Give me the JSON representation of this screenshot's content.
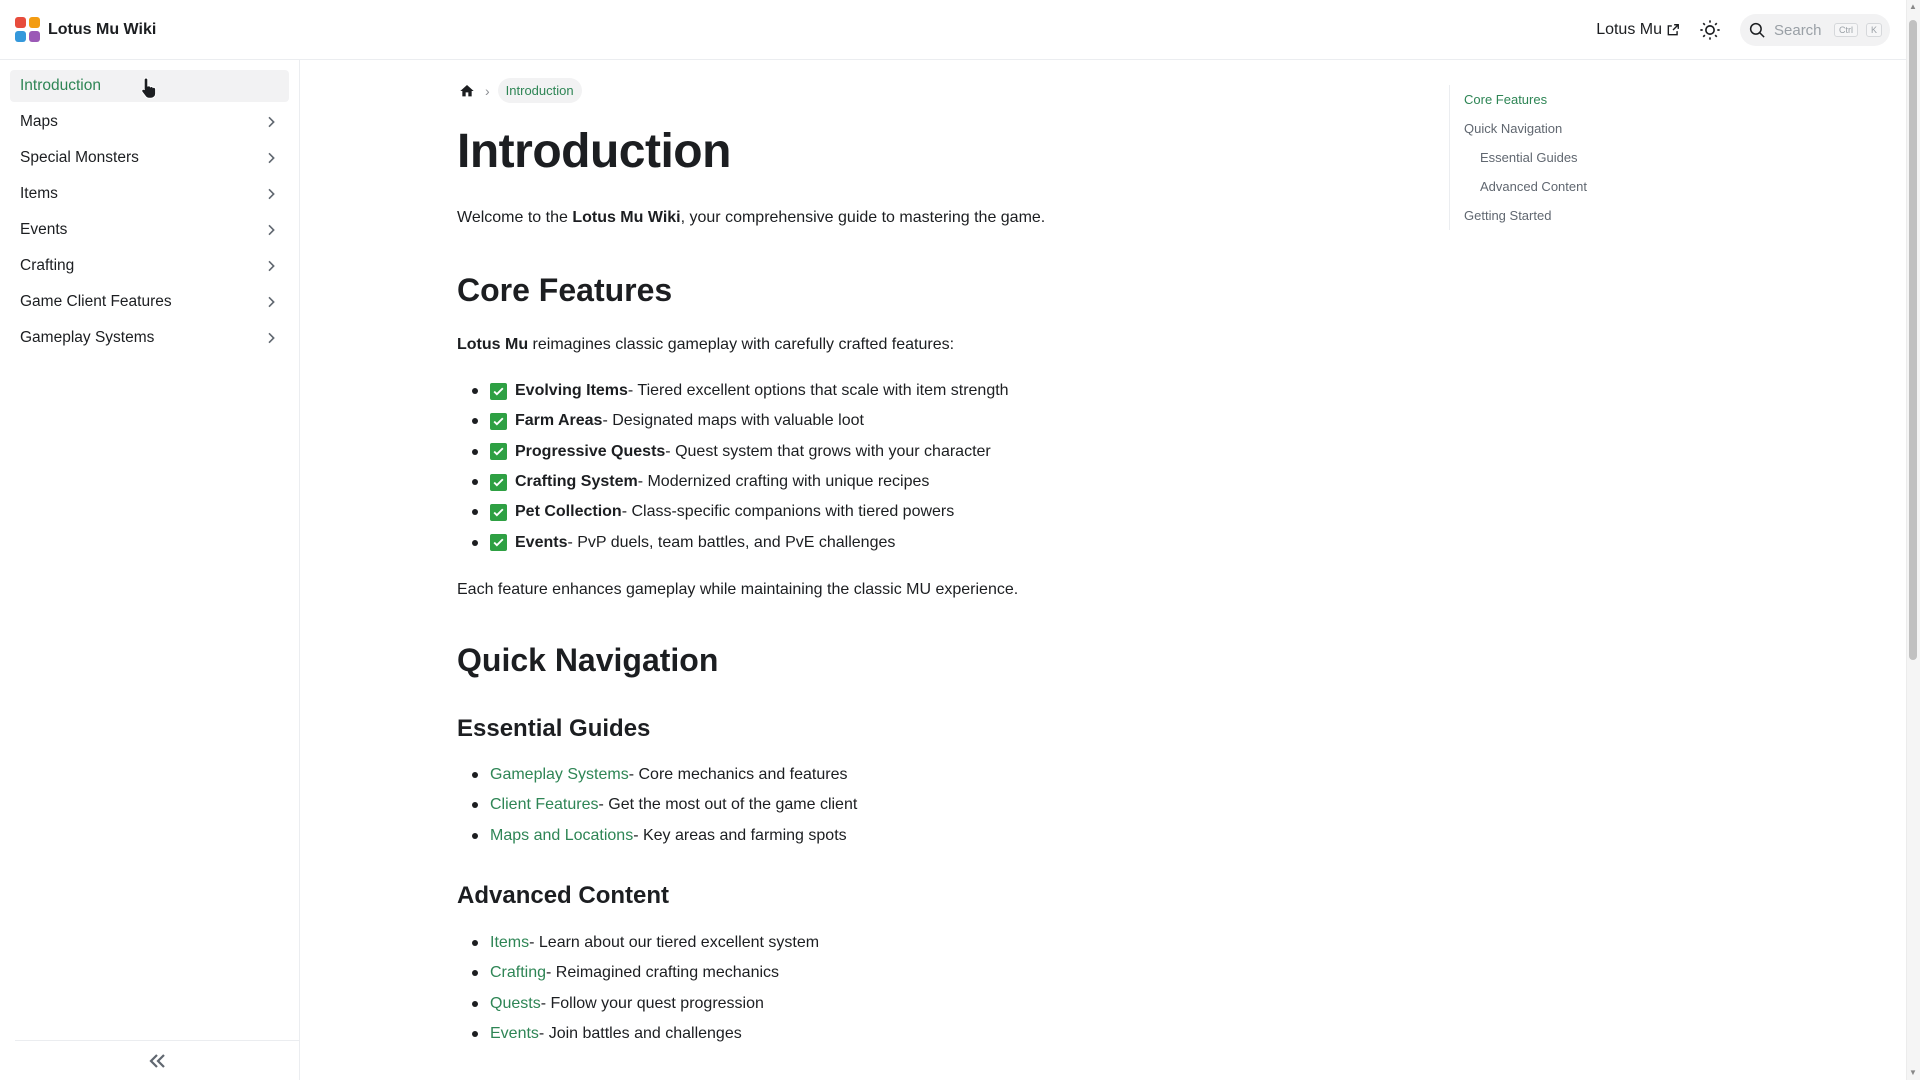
{
  "navbar": {
    "brand_title": "Lotus Mu Wiki",
    "logo_colors": [
      "#e74c3c",
      "#f39c12",
      "#3498db",
      "#9b59b6"
    ],
    "external_link_label": "Lotus Mu",
    "search_placeholder": "Search",
    "search_kbd_1": "Ctrl",
    "search_kbd_2": "K"
  },
  "sidebar": {
    "items": [
      {
        "label": "Introduction",
        "active": true
      },
      {
        "label": "Maps"
      },
      {
        "label": "Special Monsters"
      },
      {
        "label": "Items"
      },
      {
        "label": "Events"
      },
      {
        "label": "Crafting"
      },
      {
        "label": "Game Client Features"
      },
      {
        "label": "Gameplay Systems"
      }
    ]
  },
  "breadcrumb": {
    "current": "Introduction"
  },
  "main": {
    "title": "Introduction",
    "intro_prefix": "Welcome to the ",
    "intro_bold": "Lotus Mu Wiki",
    "intro_suffix": ", your comprehensive guide to mastering the game.",
    "core_features": {
      "heading": "Core Features",
      "lead_bold": "Lotus Mu",
      "lead_rest": " reimagines classic gameplay with carefully crafted features:",
      "items": [
        {
          "name": "Evolving Items",
          "desc": " - Tiered excellent options that scale with item strength"
        },
        {
          "name": "Farm Areas",
          "desc": " - Designated maps with valuable loot"
        },
        {
          "name": "Progressive Quests",
          "desc": " - Quest system that grows with your character"
        },
        {
          "name": "Crafting System",
          "desc": " - Modernized crafting with unique recipes"
        },
        {
          "name": "Pet Collection",
          "desc": " - Class-specific companions with tiered powers"
        },
        {
          "name": "Events",
          "desc": " - PvP duels, team battles, and PvE challenges"
        }
      ],
      "closing": "Each feature enhances gameplay while maintaining the classic MU experience."
    },
    "quick_navigation": {
      "heading": "Quick Navigation",
      "essential_guides": {
        "heading": "Essential Guides",
        "items": [
          {
            "link": "Gameplay Systems",
            "desc": " - Core mechanics and features"
          },
          {
            "link": "Client Features",
            "desc": " - Get the most out of the game client"
          },
          {
            "link": "Maps and Locations",
            "desc": " - Key areas and farming spots"
          }
        ]
      },
      "advanced_content": {
        "heading": "Advanced Content",
        "items": [
          {
            "link": "Items",
            "desc": " - Learn about our tiered excellent system"
          },
          {
            "link": "Crafting",
            "desc": " - Reimagined crafting mechanics"
          },
          {
            "link": "Quests",
            "desc": " - Follow your quest progression"
          },
          {
            "link": "Events",
            "desc": " - Join battles and challenges"
          }
        ]
      }
    }
  },
  "toc": {
    "items": [
      {
        "label": "Core Features",
        "level": 1,
        "active": true
      },
      {
        "label": "Quick Navigation",
        "level": 1
      },
      {
        "label": "Essential Guides",
        "level": 2
      },
      {
        "label": "Advanced Content",
        "level": 2
      },
      {
        "label": "Getting Started",
        "level": 1
      }
    ]
  },
  "colors": {
    "accent": "#2e8555",
    "check_green": "#2ea043",
    "text": "#1c1e21"
  },
  "icons": {
    "home": "home-icon",
    "chevron": "chevron-right-icon",
    "collapse": "double-chevron-left-icon",
    "theme": "sun-icon",
    "search": "search-icon",
    "external": "external-link-icon",
    "check": "check-box-icon"
  }
}
